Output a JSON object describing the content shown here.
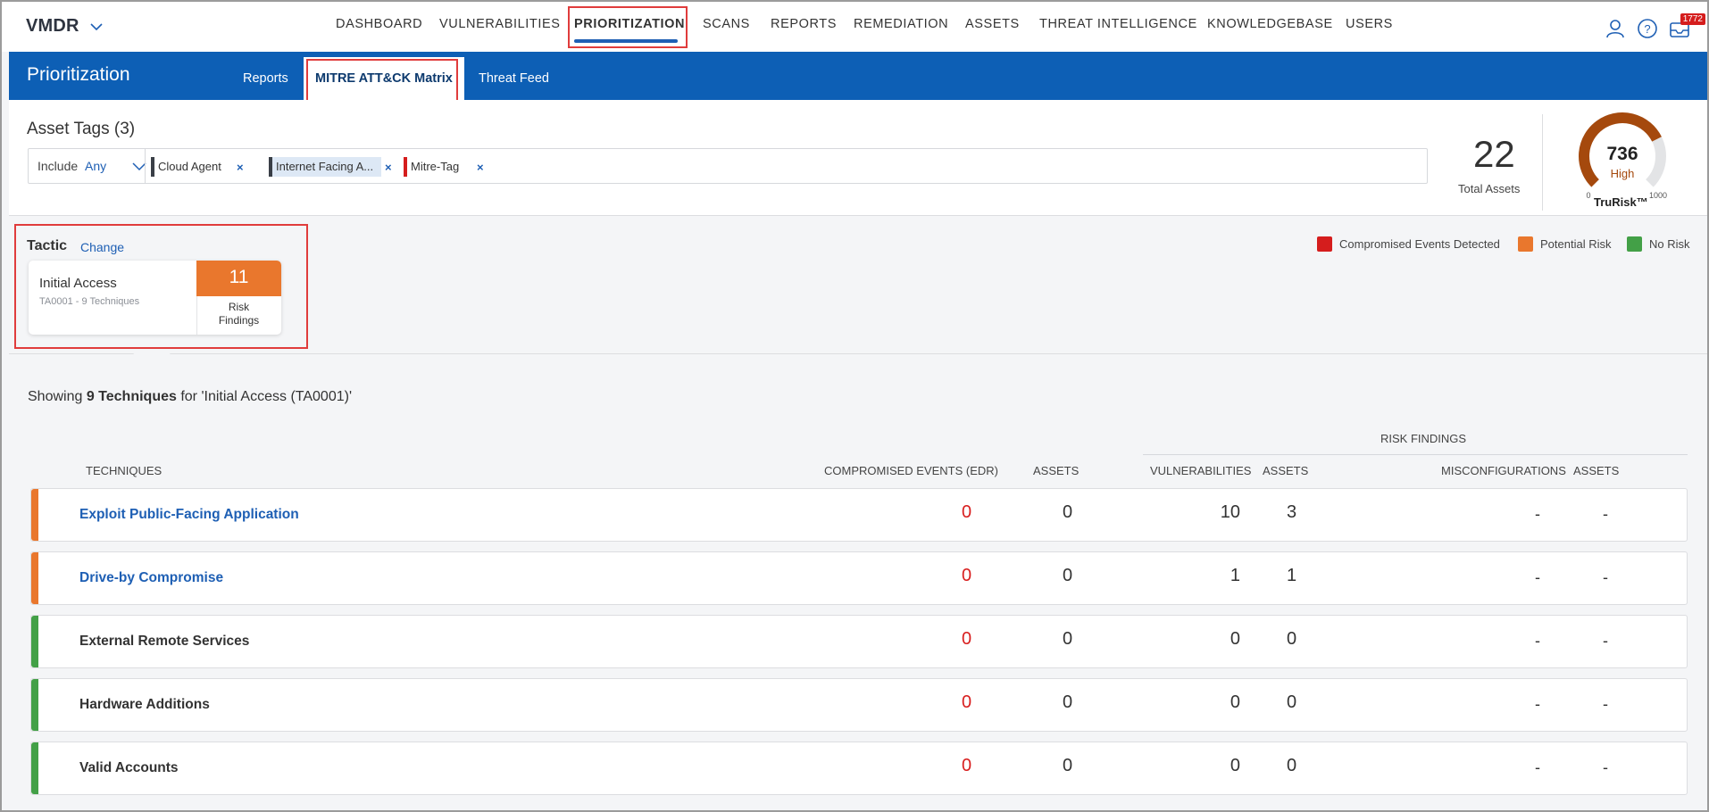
{
  "app": {
    "name": "VMDR"
  },
  "nav": {
    "items": [
      "DASHBOARD",
      "VULNERABILITIES",
      "PRIORITIZATION",
      "SCANS",
      "REPORTS",
      "REMEDIATION",
      "ASSETS",
      "THREAT INTELLIGENCE",
      "KNOWLEDGEBASE",
      "USERS"
    ],
    "active": "PRIORITIZATION",
    "notification_count": "1772"
  },
  "subheader": {
    "title": "Prioritization",
    "tabs": [
      "Reports",
      "MITRE ATT&CK Matrix",
      "Threat Feed"
    ],
    "active_tab": "MITRE ATT&CK Matrix"
  },
  "asset_tags": {
    "title": "Asset Tags (3)",
    "include_label": "Include",
    "include_value": "Any",
    "tags": [
      {
        "label": "Cloud Agent",
        "color": "#3a3f47",
        "bg": "#ffffff"
      },
      {
        "label": "Internet Facing A...",
        "color": "#3a3f47",
        "bg": "#dde8f5"
      },
      {
        "label": "Mitre-Tag",
        "color": "#d51d1d",
        "bg": "#ffffff"
      }
    ],
    "total_assets": "22",
    "total_assets_label": "Total Assets",
    "trurisk": {
      "score": "736",
      "level": "High",
      "min": "0",
      "max": "1000",
      "label": "TruRisk™",
      "fraction": 0.736,
      "color": "#a5490d"
    }
  },
  "tactic": {
    "label": "Tactic",
    "change_label": "Change",
    "name": "Initial Access",
    "sub": "TA0001 - 9 Techniques",
    "risk_count": "11",
    "risk_label_1": "Risk",
    "risk_label_2": "Findings",
    "legend": [
      {
        "label": "Compromised Events Detected",
        "color": "#d51d1d"
      },
      {
        "label": "Potential Risk",
        "color": "#e9772d"
      },
      {
        "label": "No Risk",
        "color": "#43a047"
      }
    ]
  },
  "techniques": {
    "showing_prefix": "Showing ",
    "showing_bold": "9 Techniques",
    "showing_suffix": " for 'Initial Access (TA0001)'",
    "risk_findings_header": "RISK FINDINGS",
    "columns": [
      "TECHNIQUES",
      "COMPROMISED EVENTS (EDR)",
      "ASSETS",
      "VULNERABILITIES",
      "ASSETS",
      "MISCONFIGURATIONS",
      "ASSETS"
    ],
    "rows": [
      {
        "name": "Exploit Public-Facing Application",
        "link": true,
        "risk": "#e9772d",
        "edr": "0",
        "edr_assets": "0",
        "vulns": "10",
        "vuln_assets": "3",
        "misconf": "-",
        "misconf_assets": "-"
      },
      {
        "name": "Drive-by Compromise",
        "link": true,
        "risk": "#e9772d",
        "edr": "0",
        "edr_assets": "0",
        "vulns": "1",
        "vuln_assets": "1",
        "misconf": "-",
        "misconf_assets": "-"
      },
      {
        "name": "External Remote Services",
        "link": false,
        "risk": "#43a047",
        "edr": "0",
        "edr_assets": "0",
        "vulns": "0",
        "vuln_assets": "0",
        "misconf": "-",
        "misconf_assets": "-"
      },
      {
        "name": "Hardware Additions",
        "link": false,
        "risk": "#43a047",
        "edr": "0",
        "edr_assets": "0",
        "vulns": "0",
        "vuln_assets": "0",
        "misconf": "-",
        "misconf_assets": "-"
      },
      {
        "name": "Valid Accounts",
        "link": false,
        "risk": "#43a047",
        "edr": "0",
        "edr_assets": "0",
        "vulns": "0",
        "vuln_assets": "0",
        "misconf": "-",
        "misconf_assets": "-"
      }
    ]
  }
}
